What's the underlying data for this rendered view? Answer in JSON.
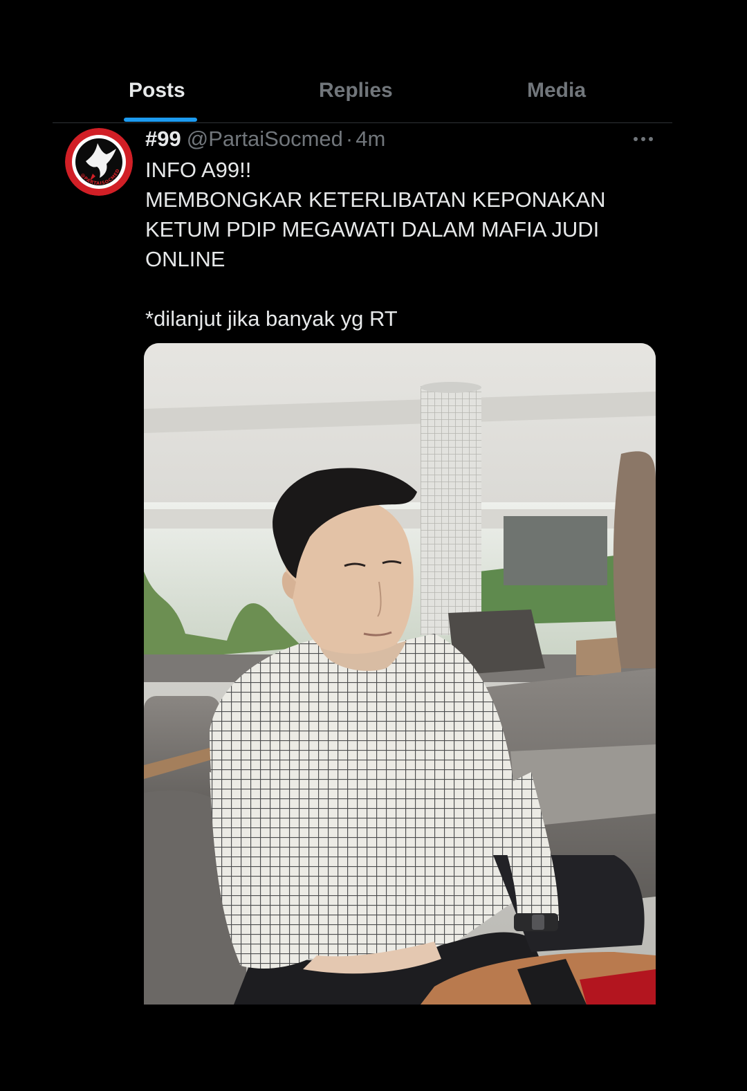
{
  "tabs": {
    "posts": "Posts",
    "replies": "Replies",
    "media": "Media",
    "active": "Posts"
  },
  "tweet": {
    "display_name": "#99",
    "handle": "@PartaiSocmed",
    "separator": "·",
    "time": "4m",
    "text_lines": [
      "INFO A99!!",
      "MEMBONGKAR KETERLIBATAN KEPONAKAN",
      "KETUM PDIP MEGAWATI DALAM MAFIA JUDI",
      "ONLINE",
      "*dilanjut jika banyak yg RT"
    ],
    "avatar_logo_text": "@PARTAISOCMED"
  },
  "icons": {
    "more": "more-horizontal-icon",
    "avatar": "dove-logo-icon"
  },
  "colors": {
    "background": "#000000",
    "text_primary": "#e7e9ea",
    "text_secondary": "#71767b",
    "accent": "#1d9bf0",
    "divider": "#2f3336",
    "logo_red": "#d11f26"
  }
}
